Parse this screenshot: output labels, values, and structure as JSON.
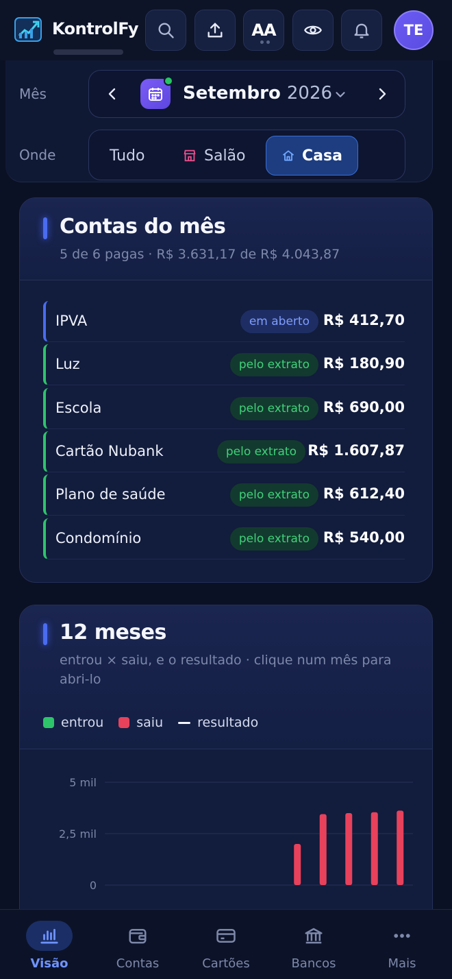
{
  "app": {
    "name": "KontrolFy"
  },
  "header": {
    "text_size_label": "AA",
    "avatar_initials": "TE"
  },
  "filters": {
    "month_label": "Mês",
    "month_name": "Setembro",
    "month_year": "2026",
    "where_label": "Onde",
    "where_options": [
      {
        "label": "Tudo",
        "active": false
      },
      {
        "label": "Salão",
        "active": false
      },
      {
        "label": "Casa",
        "active": true
      }
    ]
  },
  "bills": {
    "title": "Contas do mês",
    "subtitle": "5 de 6 pagas · R$ 3.631,17 de R$ 4.043,87",
    "items": [
      {
        "name": "IPVA",
        "status": "em aberto",
        "value": "R$ 412,70"
      },
      {
        "name": "Luz",
        "status": "pelo extrato",
        "value": "R$ 180,90"
      },
      {
        "name": "Escola",
        "status": "pelo extrato",
        "value": "R$ 690,00"
      },
      {
        "name": "Cartão Nubank",
        "status": "pelo extrato",
        "value": "R$ 1.607,87"
      },
      {
        "name": "Plano de saúde",
        "status": "pelo extrato",
        "value": "R$ 612,40"
      },
      {
        "name": "Condomínio",
        "status": "pelo extrato",
        "value": "R$ 540,00"
      }
    ]
  },
  "months": {
    "title": "12 meses",
    "subtitle": "entrou × saiu, e o resultado · clique num mês para abri-lo"
  },
  "chart_data": {
    "type": "bar",
    "categories": [
      "",
      "",
      "",
      "",
      "",
      "",
      "",
      "",
      "",
      "",
      "",
      ""
    ],
    "series": [
      {
        "name": "entrou",
        "color": "#2ec46a",
        "values": [
          0,
          0,
          0,
          0,
          0,
          0,
          0,
          0,
          0,
          0,
          0,
          0
        ]
      },
      {
        "name": "saiu",
        "color": "#e8415c",
        "values": [
          0,
          0,
          0,
          0,
          0,
          0,
          0,
          2000,
          3450,
          3500,
          3540,
          3620
        ]
      },
      {
        "name": "resultado",
        "color": "#f2f4fa",
        "values": []
      }
    ],
    "yticks": [
      "5 mil",
      "2,5 mil",
      "0"
    ],
    "ytick_values": [
      5000,
      2500,
      0
    ],
    "ylim": [
      0,
      5000
    ],
    "grid": true,
    "legend": "top-left"
  },
  "nav": {
    "items": [
      {
        "label": "Visão",
        "icon": "chart-icon",
        "active": true
      },
      {
        "label": "Contas",
        "icon": "wallet-icon",
        "active": false
      },
      {
        "label": "Cartões",
        "icon": "credit-card-icon",
        "active": false
      },
      {
        "label": "Bancos",
        "icon": "bank-icon",
        "active": false
      },
      {
        "label": "Mais",
        "icon": "more-icon",
        "active": false
      }
    ]
  },
  "colors": {
    "accent": "#4a6cf0",
    "paid": "#2ec46a",
    "expense": "#e8415c",
    "background": "#0b1124"
  }
}
